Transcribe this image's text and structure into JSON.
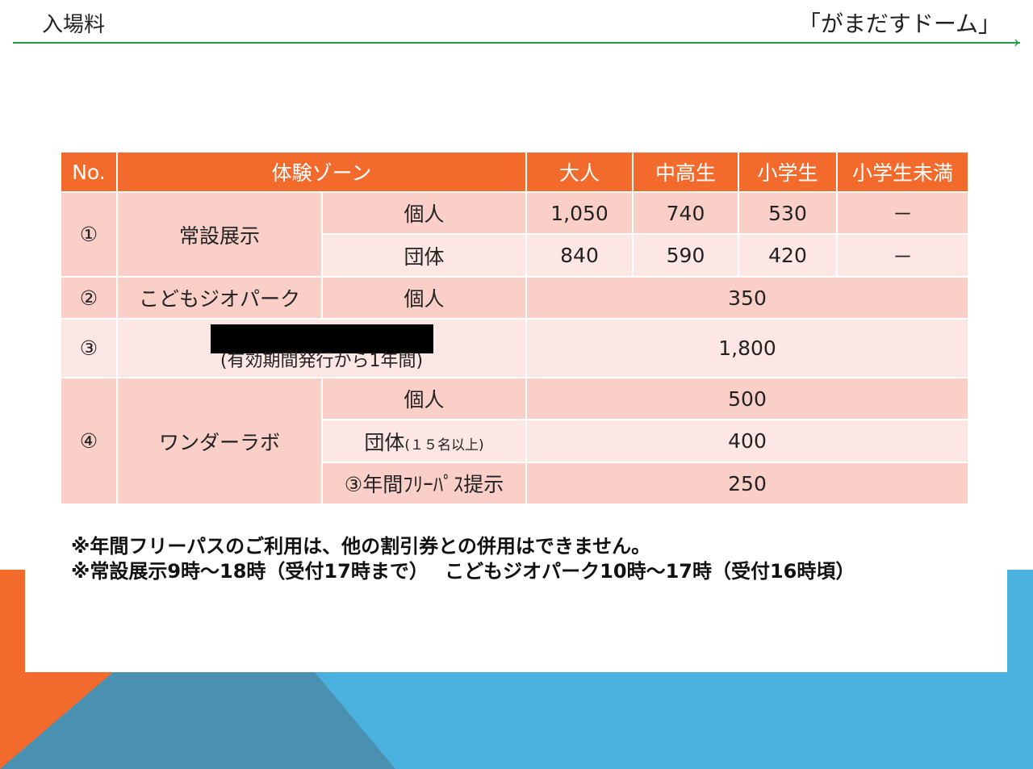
{
  "header": {
    "title": "入場料",
    "venue": "「がまだすドーム」"
  },
  "table": {
    "headers": {
      "no": "No.",
      "zone": "体験ゾーン",
      "adult": "大人",
      "highschool": "中高生",
      "elementary": "小学生",
      "under_elementary": "小学生未満"
    },
    "row1": {
      "no": "①",
      "name": "常設展示",
      "individual": {
        "label": "個人",
        "adult": "1,050",
        "highschool": "740",
        "elementary": "530",
        "under": "－"
      },
      "group": {
        "label": "団体",
        "adult": "840",
        "highschool": "590",
        "elementary": "420",
        "under": "－"
      }
    },
    "row2": {
      "no": "②",
      "name": "こどもジオパーク",
      "type": "個人",
      "price": "350"
    },
    "row3": {
      "no": "③",
      "note": "(有効期間発行から1年間)",
      "price": "1,800"
    },
    "row4": {
      "no": "④",
      "name": "ワンダーラボ",
      "individual": {
        "label": "個人",
        "price": "500"
      },
      "group": {
        "label": "団体",
        "label_small": "(１５名以上)",
        "price": "400"
      },
      "pass": {
        "label": "③年間ﾌﾘｰﾊﾟｽ提示",
        "price": "250"
      }
    }
  },
  "notes": {
    "line1": "※年間フリーパスのご利用は、他の割引券との併用はできません。",
    "line2": "※常設展示9時～18時（受付17時まで）　 こどもジオパーク10時～17時（受付16時頃）"
  },
  "colors": {
    "accent": "#f26b2d",
    "row_dark": "#f9cfc8",
    "row_light": "#fde7e4",
    "line": "#1e9c4a",
    "blue": "#4bb1de"
  }
}
